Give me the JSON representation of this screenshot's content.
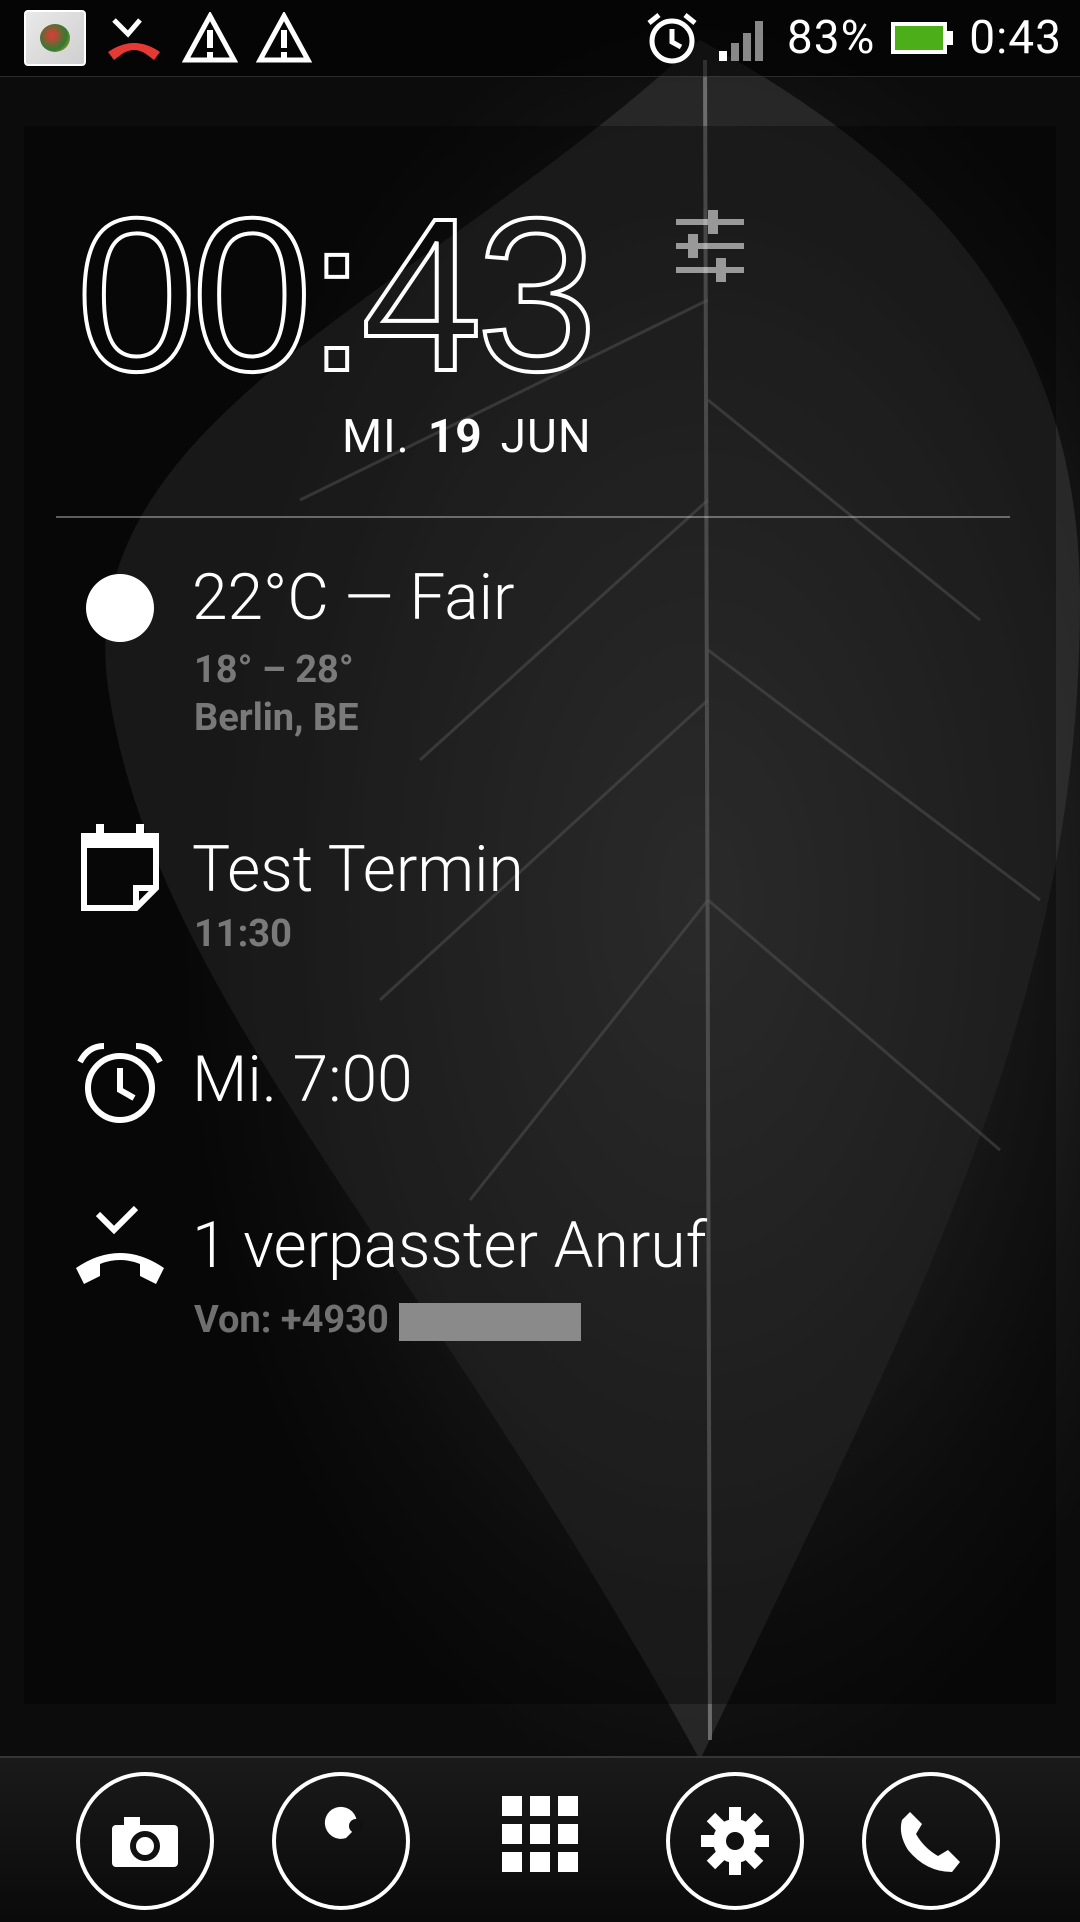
{
  "status_bar": {
    "battery_percent": "83%",
    "time": "0:43",
    "battery_level": 0.83,
    "icons": [
      "app-thumbnail-icon",
      "missed-call-icon",
      "warning-icon",
      "warning-icon",
      "alarm-icon",
      "signal-icon",
      "battery-icon"
    ]
  },
  "clock": {
    "time": "00:43",
    "day": "MI.",
    "date": "19",
    "month": "JUN"
  },
  "weather": {
    "title": "22°C — Fair",
    "range": "18° – 28°",
    "location": "Berlin, BE",
    "icon": "sun-icon"
  },
  "calendar": {
    "title": "Test Termin",
    "time": "11:30",
    "icon": "calendar-icon"
  },
  "alarm": {
    "title": "Mi. 7:00",
    "icon": "alarm-clock-icon"
  },
  "missed_call": {
    "title": "1 verpasster Anruf",
    "from": "Von: +4930",
    "icon": "missed-call-icon"
  },
  "dock": {
    "buttons": [
      "camera-icon",
      "wrench-icon",
      "app-grid-icon",
      "settings-gear-icon",
      "phone-icon"
    ]
  },
  "colors": {
    "battery_green": "#4caf1a",
    "missed_call_red": "#e53935"
  }
}
